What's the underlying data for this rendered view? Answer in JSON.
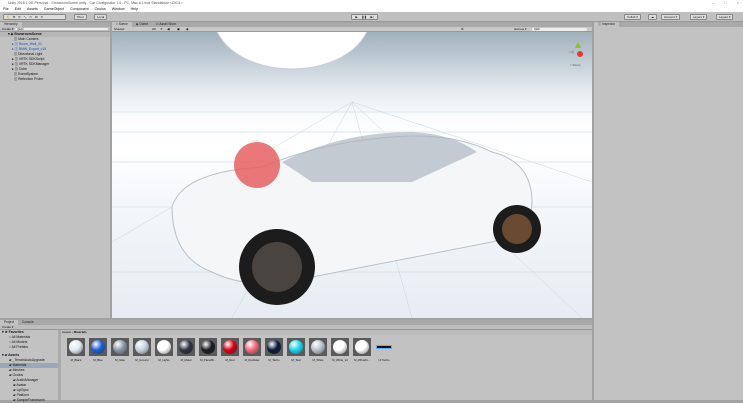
{
  "window": {
    "title": "Unity 2018.1.0f2 Personal - ShowroomScene.unity - Car Configurator 1.0 - PC, Mac & Linux Standalone <DX11>",
    "controls": [
      "–",
      "□",
      "×"
    ]
  },
  "menu": [
    "File",
    "Edit",
    "Assets",
    "GameObject",
    "Component",
    "Oculus",
    "Window",
    "Help"
  ],
  "toolbar": {
    "pivot": "Pivot",
    "local": "Local",
    "collab": "Collab ▾",
    "account": "Account ▾",
    "layers": "Layers ▾",
    "layout": "Layout ▾"
  },
  "hierarchy": {
    "tab": "Hierarchy",
    "create": "Create ▾",
    "search_placeholder": "Q▾All",
    "scene": "ShowroomScene",
    "items": [
      {
        "label": "Main Camera",
        "blue": false,
        "arrow": false
      },
      {
        "label": "Room_Wall_01",
        "blue": true,
        "arrow": true
      },
      {
        "label": "BMW_Export_v15",
        "blue": true,
        "arrow": true
      },
      {
        "label": "Directional Light",
        "blue": false,
        "arrow": false
      },
      {
        "label": "VRTK SDKScript",
        "blue": false,
        "arrow": true
      },
      {
        "label": "VRTK SDKManager",
        "blue": false,
        "arrow": true
      },
      {
        "label": "Cube",
        "blue": false,
        "arrow": true
      },
      {
        "label": "EventSystem",
        "blue": false,
        "arrow": false
      },
      {
        "label": "Reflection Probe",
        "blue": false,
        "arrow": false
      }
    ]
  },
  "scene": {
    "tabs": [
      "Scene",
      "Game",
      "Asset Store"
    ],
    "shading": "Shaded",
    "mode_2d": "2D",
    "gizmos": "Gizmos ▾",
    "search": "Q▾All",
    "persp": "< Persp"
  },
  "inspector": {
    "tab": "Inspector"
  },
  "project": {
    "tabs": [
      "Project",
      "Console"
    ],
    "create": "Create ▾",
    "favorites": "Favorites",
    "fav_items": [
      "All Materials",
      "All Models",
      "All Prefabs"
    ],
    "assets": "Assets",
    "tree": [
      "_TerrainAutoUpgrade",
      "Materials",
      "Meshes",
      "Oculus",
      "AudioManager",
      "Avatar",
      "LipSync",
      "Platform",
      "SampleFramework"
    ],
    "breadcrumb": [
      "Assets",
      "Materials"
    ],
    "materials": [
      {
        "name": "M_Black",
        "color": "#dfe8f2"
      },
      {
        "name": "M_Blue",
        "color": "#1a5fd8"
      },
      {
        "name": "M_Glas",
        "color": "#8a98a8"
      },
      {
        "name": "M_Ground",
        "color": "#c8d2e0"
      },
      {
        "name": "M_Lights",
        "color": "#ffffff"
      },
      {
        "name": "M_Metal",
        "color": "#2c3440"
      },
      {
        "name": "M_PianoBl...",
        "color": "#1a1c20"
      },
      {
        "name": "M_Red",
        "color": "#d80010"
      },
      {
        "name": "M_RedGlas",
        "color": "#f26a78"
      },
      {
        "name": "M_Tacho",
        "color": "#0d1a38"
      },
      {
        "name": "M_Teal",
        "color": "#1ed4f2"
      },
      {
        "name": "M_White",
        "color": "#b8c2d0"
      },
      {
        "name": "M_White_Int",
        "color": "#ffffff"
      },
      {
        "name": "M_WhiteM...",
        "color": "#ffffff"
      }
    ],
    "ui_tacho": "UI Tacho"
  }
}
